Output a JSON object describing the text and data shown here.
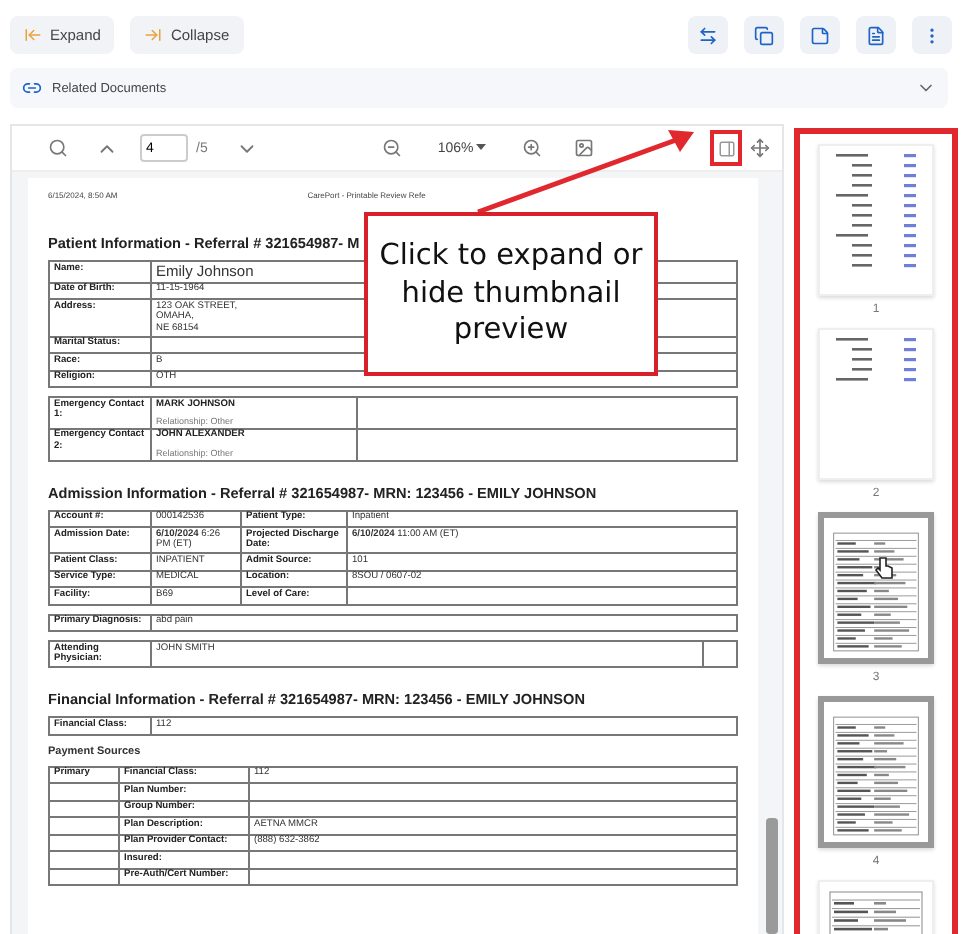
{
  "top_bar": {
    "buttons": [
      {
        "label": "Expand",
        "kind": "expand"
      },
      {
        "label": "Collapse",
        "kind": "collapse"
      }
    ],
    "actions": [
      {
        "kind": "swap"
      },
      {
        "kind": "copy"
      },
      {
        "kind": "note"
      },
      {
        "kind": "file"
      },
      {
        "kind": "more"
      }
    ]
  },
  "related_documents": {
    "label": "Related Documents",
    "expanded": false
  },
  "viewer_toolbar": {
    "page": "4",
    "page_total": "/5",
    "zoom": "106%"
  },
  "document": {
    "header_date": "6/15/2024, 8:50 AM",
    "header_title": "CarePort - Printable Review Refe",
    "sections": [
      {
        "heading": "Patient Information - Referral # 321654987- M",
        "tables": [
          {
            "kind": "pairs",
            "rows": [
              {
                "label": "Name:",
                "value": "Emily Johnson",
                "kind": "name"
              },
              {
                "label": "Date of Birth:",
                "value": "11-15-1964"
              },
              {
                "label": "Address:",
                "value": "123 OAK STREET,\nOMAHA,\nNE 68154"
              },
              {
                "label": "Marital Status:"
              },
              {
                "label": "Race:",
                "value": "B"
              },
              {
                "label": "Religion:",
                "value": "OTH"
              }
            ]
          },
          {
            "kind": "contacts",
            "rows": [
              {
                "label": "Emergency Contact 1:",
                "name": "MARK JOHNSON",
                "relationship": "Relationship: Other"
              },
              {
                "label": "Emergency Contact 2:",
                "name": "JOHN ALEXANDER",
                "relationship": "Relationship: Other"
              }
            ]
          }
        ]
      },
      {
        "heading": "Admission Information - Referral # 321654987- MRN: 123456    - EMILY JOHNSON",
        "tables": [
          {
            "kind": "grid",
            "rows": [
              [
                "Account #:",
                "000142536",
                "Patient Type:",
                "Inpatient"
              ],
              [
                "Admission Date:",
                "**6/10/2024** 6:26 PM (ET)",
                "Projected Discharge Date:",
                "**6/10/2024** 11:00 AM (ET)"
              ],
              [
                "Patient Class:",
                "INPATIENT",
                "Admit Source:",
                "101"
              ],
              [
                "Service Type:",
                "MEDICAL",
                "Location:",
                "8SOU / 0607-02"
              ],
              [
                "Facility:",
                "B69",
                "Level of Care:"
              ]
            ]
          },
          {
            "kind": "pairs",
            "rows": [
              {
                "label": "Primary Diagnosis:",
                "value": "abd pain"
              }
            ]
          },
          {
            "kind": "pairs",
            "extra_cell": true,
            "rows": [
              {
                "label": "Attending Physician:",
                "value": "JOHN SMITH"
              }
            ]
          }
        ]
      },
      {
        "heading": "Financial Information - Referral # 321654987- MRN: 123456    - EMILY JOHNSON",
        "tables": [
          {
            "kind": "pairs",
            "rows": [
              {
                "label": "Financial Class:",
                "value": "112"
              }
            ]
          },
          {
            "kind": "subheading",
            "text": "Payment Sources"
          },
          {
            "kind": "payment",
            "rows": [
              {
                "source": "Primary",
                "label": "Financial Class:",
                "value": "112"
              },
              {
                "label": "Plan Number:"
              },
              {
                "label": "Group Number:"
              },
              {
                "label": "Plan Description:",
                "value": "AETNA MMCR"
              },
              {
                "label": "Plan Provider Contact:",
                "value": "(888) 632-3862"
              },
              {
                "label": "Insured:"
              },
              {
                "label": "Pre-Auth/Cert Number:"
              }
            ]
          }
        ]
      }
    ]
  },
  "thumbnails": [
    {
      "number": "1",
      "kind": "text",
      "highlighted": false,
      "pointer": false
    },
    {
      "number": "2",
      "kind": "short",
      "highlighted": false,
      "pointer": false
    },
    {
      "number": "3",
      "kind": "form",
      "highlighted": true,
      "pointer": true
    },
    {
      "number": "4",
      "kind": "form",
      "highlighted": true,
      "pointer": false
    },
    {
      "kind": "form",
      "highlighted": false,
      "pointer": false
    }
  ],
  "callout": {
    "text": "Click to expand or hide thumbnail preview"
  }
}
